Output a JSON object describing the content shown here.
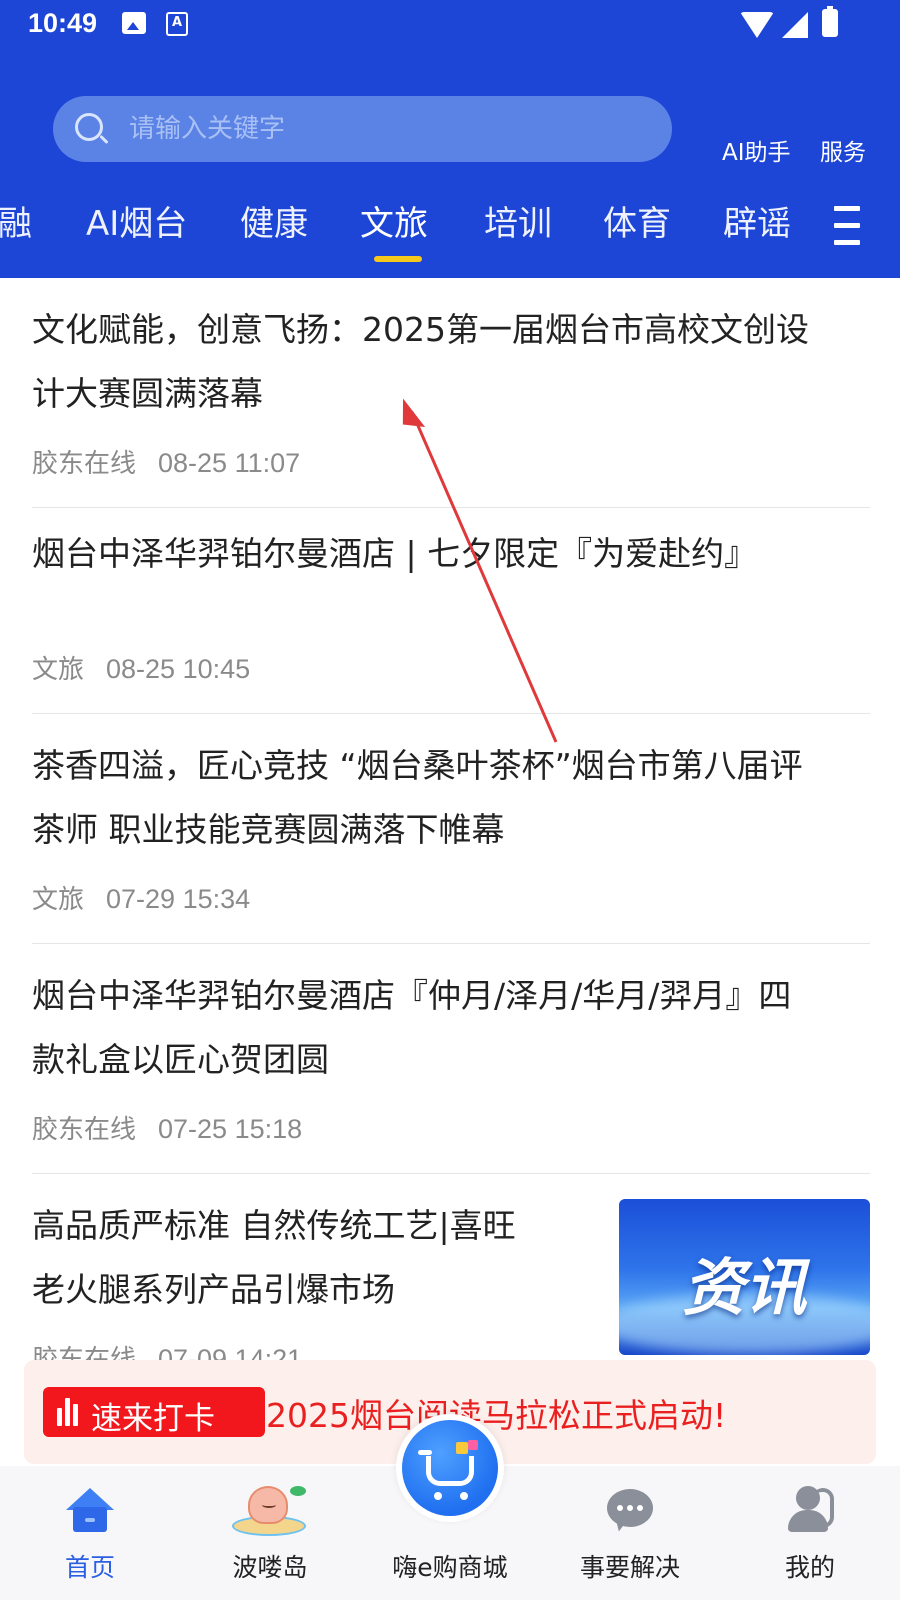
{
  "status_bar": {
    "time": "10:49",
    "icons": [
      "image-icon",
      "a-notification-icon",
      "wifi-icon",
      "cell-signal-icon",
      "battery-charging-icon"
    ]
  },
  "header": {
    "search_placeholder": "请输入关键字",
    "ai_assistant": "AI助手",
    "services": "服务"
  },
  "tabs": [
    {
      "label": "融",
      "active": false
    },
    {
      "label": "AI烟台",
      "active": false
    },
    {
      "label": "健康",
      "active": false
    },
    {
      "label": "文旅",
      "active": true
    },
    {
      "label": "培训",
      "active": false
    },
    {
      "label": "体育",
      "active": false
    },
    {
      "label": "辟谣",
      "active": false
    }
  ],
  "news": [
    {
      "title_line1": "文化赋能，创意飞扬：2025第一届烟台市高校文创设",
      "title_line2": "计大赛圆满落幕",
      "source": "胶东在线",
      "time": "08-25 11:07"
    },
    {
      "title_line1": "烟台中泽华羿铂尔曼酒店 | 七夕限定『为爱赴约』",
      "title_line2": "",
      "source": "文旅",
      "time": "08-25 10:45"
    },
    {
      "title_line1": "茶香四溢，匠心竞技 “烟台桑叶茶杯”烟台市第八届评",
      "title_line2": "茶师 职业技能竞赛圆满落下帷幕",
      "source": "文旅",
      "time": "07-29 15:34"
    },
    {
      "title_line1": "烟台中泽华羿铂尔曼酒店『仲月/泽月/华月/羿月』四",
      "title_line2": "款礼盒以匠心贺团圆",
      "source": "胶东在线",
      "time": "07-25 15:18"
    },
    {
      "title_line1": "高品质严标准 自然传统工艺|喜旺",
      "title_line2": "老火腿系列产品引爆市场",
      "source": "胶东在线",
      "time": "07-09 14:21",
      "thumbnail_text": "资讯"
    }
  ],
  "banner": {
    "badge": "速来打卡",
    "text": "2025烟台阅读马拉松正式启动!"
  },
  "bottom_nav": [
    {
      "label": "首页",
      "icon": "home-icon",
      "active": true
    },
    {
      "label": "波喽岛",
      "icon": "island-mascot-icon",
      "active": false
    },
    {
      "label": "嗨e购商城",
      "icon": "shopping-cart-icon",
      "active": false
    },
    {
      "label": "事要解决",
      "icon": "chat-bubble-icon",
      "active": false
    },
    {
      "label": "我的",
      "icon": "user-icon",
      "active": false
    }
  ],
  "colors": {
    "header_blue": "#1d45d6",
    "tab_underline": "#f6c81c",
    "banner_red": "#f2161d",
    "nav_active": "#2a5ee3"
  }
}
